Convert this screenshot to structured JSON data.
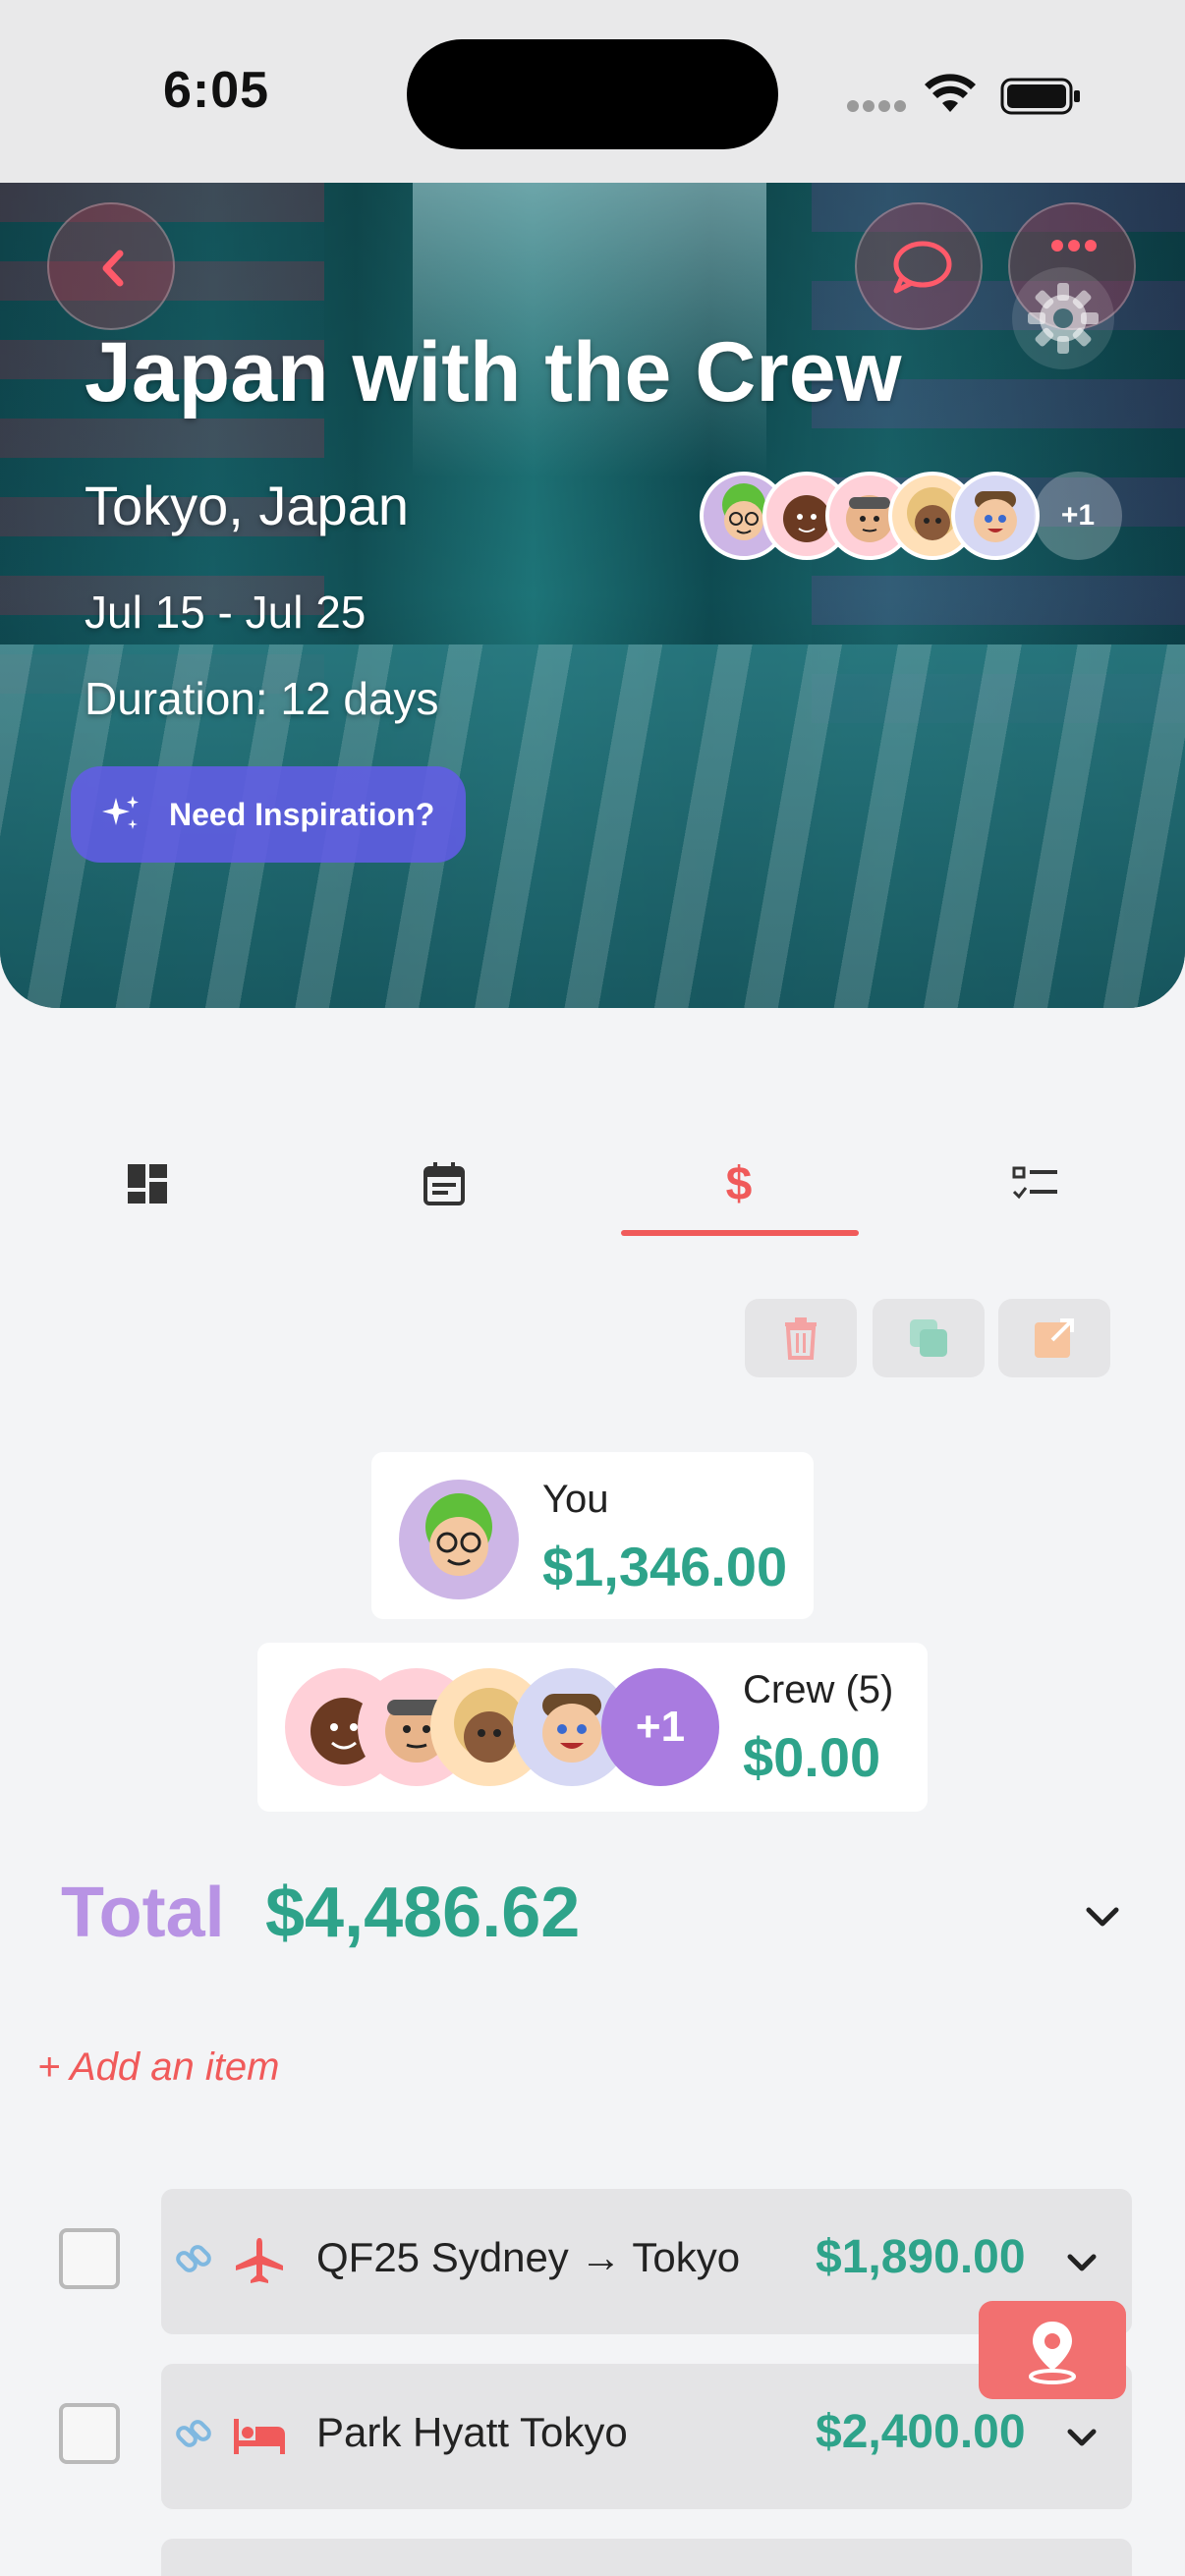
{
  "status_bar": {
    "time": "6:05"
  },
  "trip": {
    "title": "Japan with the Crew",
    "location": "Tokyo, Japan",
    "dates": "Jul 15 - Jul 25",
    "duration": "Duration: 12 days",
    "inspiration_label": "Need Inspiration?",
    "crew_extra": "+1"
  },
  "tabs": [
    {
      "icon": "dashboard-icon"
    },
    {
      "icon": "calendar-icon"
    },
    {
      "icon": "dollar-icon",
      "label": "$",
      "active": true
    },
    {
      "icon": "checklist-icon"
    }
  ],
  "actions": {
    "delete_icon": "trash-icon",
    "copy_icon": "copy-icon",
    "export_icon": "share-icon"
  },
  "budget": {
    "you_label": "You",
    "you_amount": "$1,346.00",
    "crew_label": "Crew (5)",
    "crew_amount": "$0.00",
    "crew_extra": "+1",
    "total_label": "Total",
    "total_value": "$4,486.62",
    "add_item": "+ Add an item"
  },
  "items": [
    {
      "type": "flight",
      "label": "QF25 Sydney → Tokyo",
      "price": "$1,890.00"
    },
    {
      "type": "hotel",
      "label": "Park Hyatt Tokyo",
      "price": "$2,400.00"
    }
  ],
  "colors": {
    "accent": "#f05a5a",
    "money": "#2ea38a",
    "total_label": "#b893e4",
    "inspiration": "#625ce6",
    "crew_plus": "#a97be0"
  }
}
